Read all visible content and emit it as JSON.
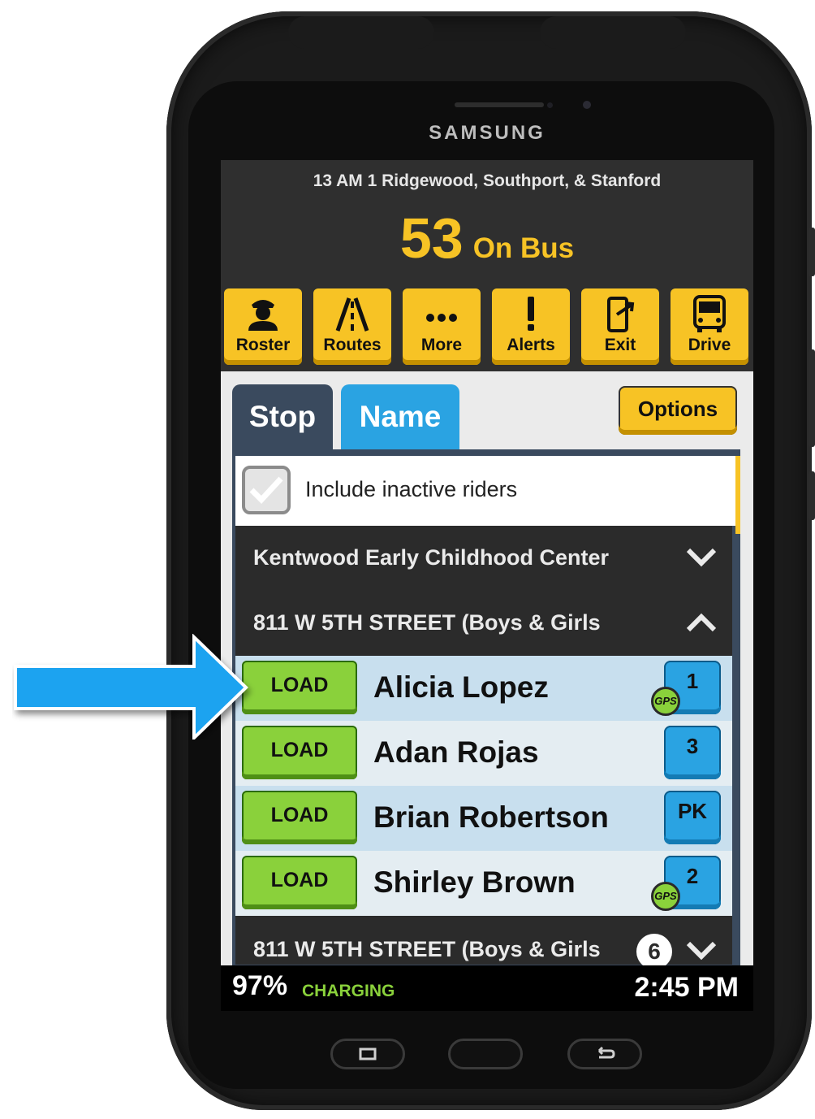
{
  "device": {
    "brand": "SAMSUNG"
  },
  "header": {
    "route": "13 AM 1 Ridgewood, Southport, & Stanford",
    "count": "53",
    "count_label": "On Bus"
  },
  "toolbar": [
    {
      "label": "Roster",
      "icon": "person-icon"
    },
    {
      "label": "Routes",
      "icon": "road-icon"
    },
    {
      "label": "More",
      "icon": "more-icon"
    },
    {
      "label": "Alerts",
      "icon": "alert-icon"
    },
    {
      "label": "Exit",
      "icon": "exit-icon"
    },
    {
      "label": "Drive",
      "icon": "bus-icon"
    }
  ],
  "tabs": {
    "stop": "Stop",
    "name": "Name",
    "active": "Stop"
  },
  "options_label": "Options",
  "inactive_toggle": {
    "label": "Include inactive riders",
    "checked": true
  },
  "groups": [
    {
      "title": "Kentwood Early Childhood Center",
      "expanded": false
    },
    {
      "title": "811 W 5TH STREET (Boys & Girls",
      "expanded": true
    }
  ],
  "riders": [
    {
      "action": "LOAD",
      "name": "Alicia Lopez",
      "grade": "1",
      "gps": true
    },
    {
      "action": "LOAD",
      "name": "Adan Rojas",
      "grade": "3",
      "gps": false
    },
    {
      "action": "LOAD",
      "name": "Brian Robertson",
      "grade": "PK",
      "gps": false
    },
    {
      "action": "LOAD",
      "name": "Shirley Brown",
      "grade": "2",
      "gps": true
    }
  ],
  "gps_badge": "GPS",
  "partial_group": {
    "title": "811 W 5TH STREET (Boys & Girls",
    "count": "6"
  },
  "status_bar": {
    "battery": "97%",
    "charging": "CHARGING",
    "time": "2:45 PM"
  },
  "colors": {
    "accent": "#f7c325",
    "load": "#8ad13b",
    "tab_name": "#2aa3e2",
    "pointer_arrow": "#1ea3f0"
  }
}
